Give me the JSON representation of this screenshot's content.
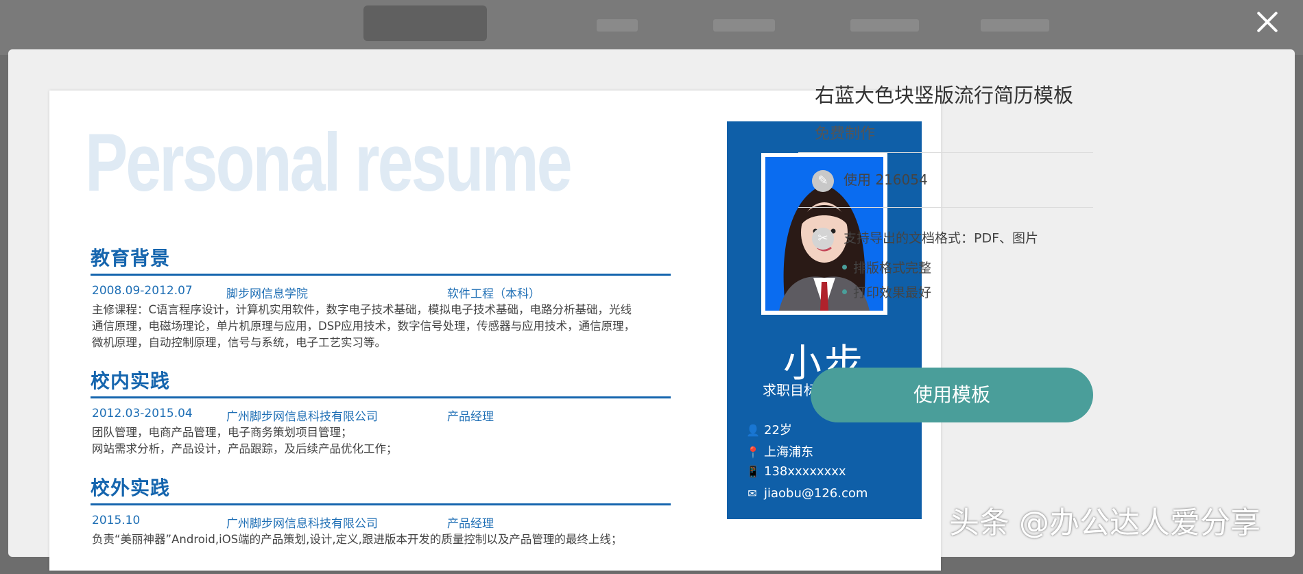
{
  "resume": {
    "watermark": "Personal resume",
    "sections": [
      {
        "title": "教育背景",
        "date": "2008.09-2012.07",
        "org": "脚步网信息学院",
        "role": "软件工程（本科）",
        "desc": [
          "主修课程：C语言程序设计，计算机实用软件，数字电子技术基础，模拟电子技术基础，电路分析基础，光线",
          "通信原理，电磁场理论，单片机原理与应用，DSP应用技术，数字信号处理，传感器与应用技术，通信原理，",
          "微机原理，自动控制原理，信号与系统，电子工艺实习等。"
        ]
      },
      {
        "title": "校内实践",
        "date": "2012.03-2015.04",
        "org": "广州脚步网信息科技有限公司",
        "role": "产品经理",
        "desc": [
          "团队管理，电商产品管理，电子商务策划项目管理；",
          "网站需求分析，产品设计，产品跟踪，及后续产品优化工作；"
        ]
      },
      {
        "title": "校外实践",
        "date": "2015.10",
        "org": "广州脚步网信息科技有限公司",
        "role": "产品经理",
        "desc": [
          "负责“美丽神器”Android,iOS端的产品策划,设计,定义,跟进版本开发的质量控制以及产品管理的最终上线；"
        ]
      }
    ],
    "profile": {
      "name": "小步",
      "goal": "求职目标：产品专员",
      "age": "22岁",
      "location": "上海浦东",
      "phone": "138xxxxxxxx",
      "email": "jiaobu@126.com"
    }
  },
  "template": {
    "title": "右蓝大色块竖版流行简历模板",
    "price": "免费制作",
    "use_count": "使用 216054",
    "export": "支持导出的文档格式：PDF、图片",
    "features": [
      "排版格式完整",
      "打印效果最好"
    ],
    "button": "使用模板"
  },
  "credit": "头条 @办公达人爱分享",
  "colors": {
    "accent": "#1565ae",
    "button": "#4a9e9a"
  }
}
